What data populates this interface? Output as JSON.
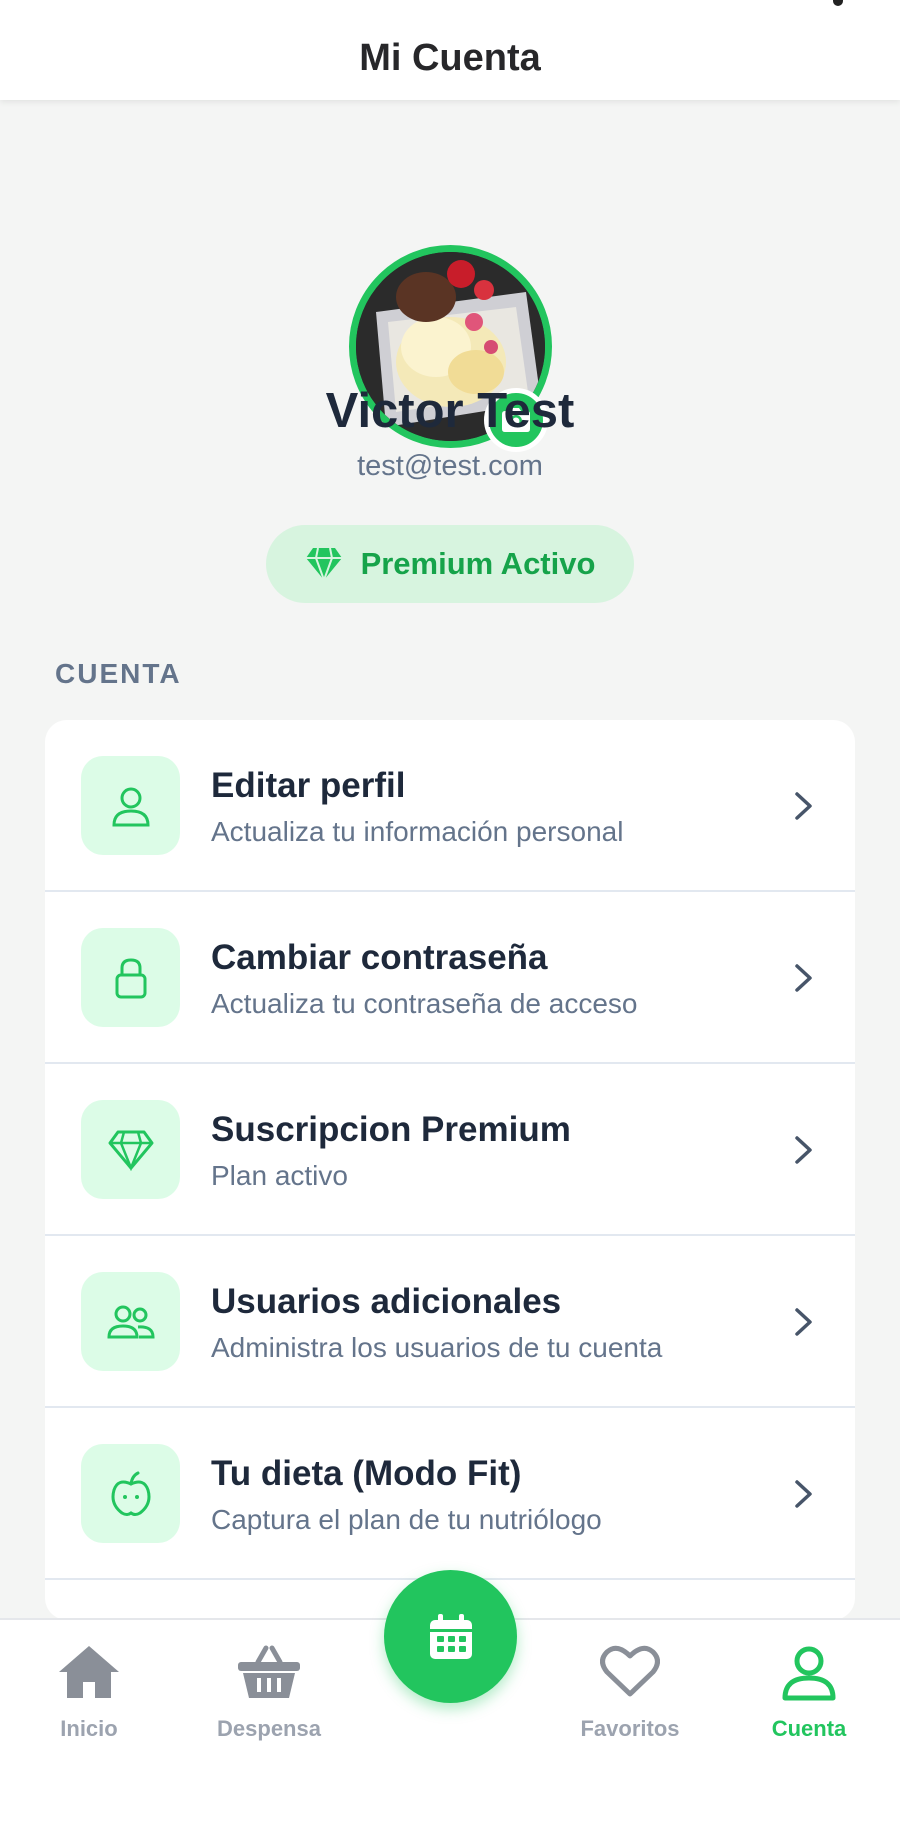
{
  "header": {
    "title": "Mi Cuenta"
  },
  "profile": {
    "name": "Victor Test",
    "email": "test@test.com",
    "premium_badge": "Premium Activo"
  },
  "section": {
    "label": "CUENTA"
  },
  "menu": [
    {
      "title": "Editar perfil",
      "subtitle": "Actualiza tu información personal",
      "icon": "user-icon"
    },
    {
      "title": "Cambiar contraseña",
      "subtitle": "Actualiza tu contraseña de acceso",
      "icon": "lock-icon"
    },
    {
      "title": "Suscripcion Premium",
      "subtitle": "Plan activo",
      "icon": "diamond-icon"
    },
    {
      "title": "Usuarios adicionales",
      "subtitle": "Administra los usuarios de tu cuenta",
      "icon": "users-icon"
    },
    {
      "title": "Tu dieta (Modo Fit)",
      "subtitle": "Captura el plan de tu nutriólogo",
      "icon": "apple-icon"
    }
  ],
  "nav": {
    "items": [
      {
        "label": "Inicio",
        "icon": "home-icon",
        "active": false
      },
      {
        "label": "Despensa",
        "icon": "basket-icon",
        "active": false
      },
      {
        "label": "Favoritos",
        "icon": "heart-icon",
        "active": false
      },
      {
        "label": "Cuenta",
        "icon": "user-icon",
        "active": true
      }
    ],
    "center_button_icon": "calendar-icon"
  },
  "colors": {
    "accent": "#22c55e",
    "accent_light": "#dcfce7",
    "text_dark": "#1e293b",
    "text_muted": "#64748b",
    "nav_inactive": "#9ca3af"
  }
}
